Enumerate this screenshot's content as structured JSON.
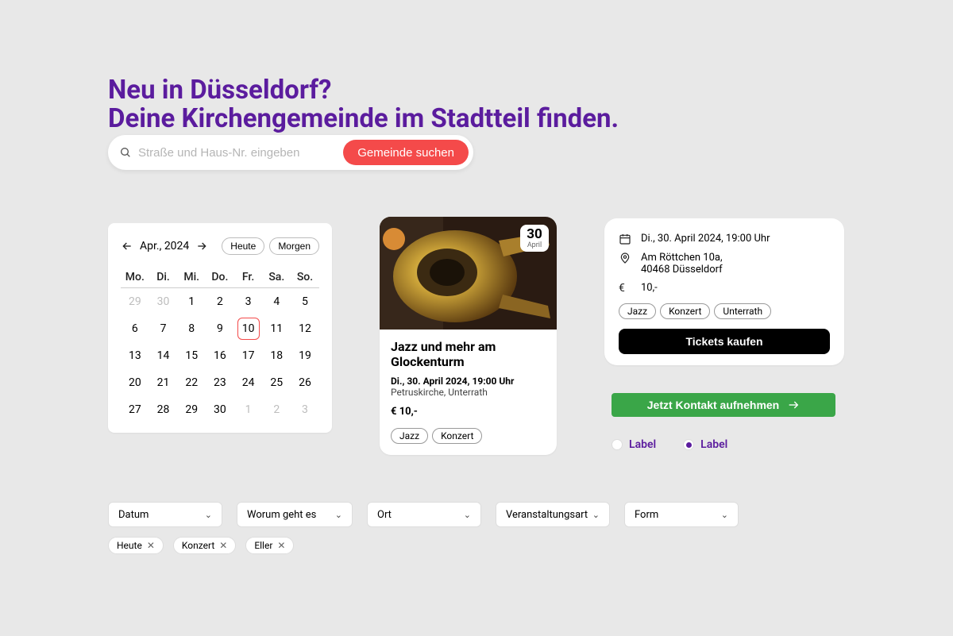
{
  "headline": {
    "line1": "Neu in Düsseldorf?",
    "line2": "Deine Kirchengemeinde im Stadtteil finden."
  },
  "search": {
    "placeholder": "Straße und Haus-Nr. eingeben",
    "button": "Gemeinde suchen"
  },
  "calendar": {
    "month_label": "Apr., 2024",
    "today_btn": "Heute",
    "tomorrow_btn": "Morgen",
    "days": [
      "Mo.",
      "Di.",
      "Mi.",
      "Do.",
      "Fr.",
      "Sa.",
      "So."
    ],
    "cells": [
      {
        "v": "29",
        "dim": true
      },
      {
        "v": "30",
        "dim": true
      },
      {
        "v": "1"
      },
      {
        "v": "2"
      },
      {
        "v": "3"
      },
      {
        "v": "4"
      },
      {
        "v": "5"
      },
      {
        "v": "6"
      },
      {
        "v": "7"
      },
      {
        "v": "8"
      },
      {
        "v": "9"
      },
      {
        "v": "10",
        "today": true
      },
      {
        "v": "11"
      },
      {
        "v": "12"
      },
      {
        "v": "13"
      },
      {
        "v": "14"
      },
      {
        "v": "15"
      },
      {
        "v": "16"
      },
      {
        "v": "17"
      },
      {
        "v": "18"
      },
      {
        "v": "19"
      },
      {
        "v": "20"
      },
      {
        "v": "21"
      },
      {
        "v": "22"
      },
      {
        "v": "23"
      },
      {
        "v": "24"
      },
      {
        "v": "25"
      },
      {
        "v": "26"
      },
      {
        "v": "27"
      },
      {
        "v": "28"
      },
      {
        "v": "29"
      },
      {
        "v": "30"
      },
      {
        "v": "1",
        "dim": true
      },
      {
        "v": "2",
        "dim": true
      },
      {
        "v": "3",
        "dim": true
      }
    ]
  },
  "event": {
    "badge_day": "30",
    "badge_month": "April",
    "title": "Jazz und mehr am Glockenturm",
    "datetime": "Di., 30. April 2024, 19:00 Uhr",
    "location": "Petruskirche, Unterrath",
    "price": "€  10,-",
    "tags": [
      "Jazz",
      "Konzert"
    ]
  },
  "info": {
    "datetime": "Di., 30. April 2024, 19:00 Uhr",
    "address_line1": "Am Röttchen 10a,",
    "address_line2": "40468 Düsseldorf",
    "price": "10,-",
    "tags": [
      "Jazz",
      "Konzert",
      "Unterrath"
    ],
    "buy_button": "Tickets kaufen"
  },
  "contact_button": "Jetzt Kontakt aufnehmen",
  "radios": {
    "a": "Label",
    "b": "Label"
  },
  "filters": {
    "items": [
      "Datum",
      "Worum geht es",
      "Ort",
      "Veranstaltungsart",
      "Form"
    ],
    "widths": [
      144,
      146,
      144,
      144,
      144
    ]
  },
  "chips": [
    "Heute",
    "Konzert",
    "Eller"
  ]
}
